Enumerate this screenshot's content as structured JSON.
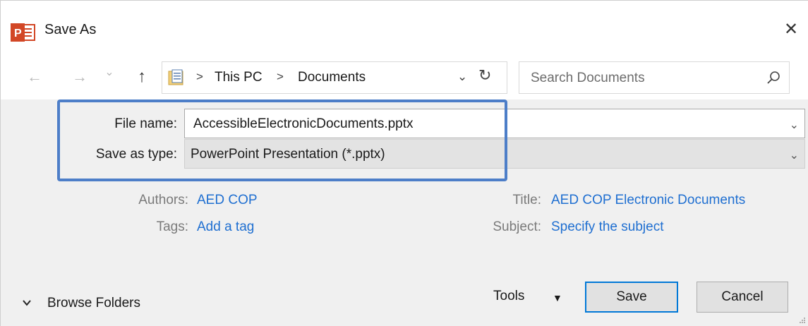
{
  "window": {
    "title": "Save As",
    "app_icon": "powerpoint-icon",
    "close_glyph": "✕"
  },
  "nav": {
    "back_glyph": "←",
    "forward_glyph": "→",
    "recent_glyph": "⌄",
    "up_glyph": "↑",
    "breadcrumb": [
      "This PC",
      "Documents"
    ],
    "sep_glyph": ">",
    "dropdown_glyph": "⌄",
    "refresh_glyph": "↻",
    "search_placeholder": "Search Documents"
  },
  "form": {
    "file_name_label": "File name:",
    "file_name_value": "AccessibleElectronicDocuments.pptx",
    "save_type_label": "Save as type:",
    "save_type_value": "PowerPoint Presentation (*.pptx)",
    "drop_glyph": "⌄"
  },
  "meta": {
    "authors_label": "Authors:",
    "authors_value": "AED COP",
    "tags_label": "Tags:",
    "tags_value": "Add a tag",
    "title_label": "Title:",
    "title_value": "AED COP Electronic Documents",
    "subject_label": "Subject:",
    "subject_value": "Specify the subject"
  },
  "footer": {
    "browse_label": "Browse Folders",
    "tools_label": "Tools",
    "tools_arrow": "▼",
    "save_label": "Save",
    "cancel_label": "Cancel"
  },
  "colors": {
    "accent": "#0078d7",
    "link": "#1f6fd1",
    "highlight_border": "#4d7ec8",
    "powerpoint": "#d24726",
    "panel": "#f0f0f0"
  }
}
